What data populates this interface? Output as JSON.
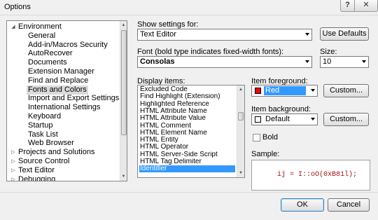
{
  "window": {
    "title": "Options",
    "help_label": "?",
    "close_label": "✕"
  },
  "tree": {
    "items": [
      {
        "label": "Environment",
        "level": 0,
        "expanded": true
      },
      {
        "label": "General",
        "level": 1
      },
      {
        "label": "Add-in/Macros Security",
        "level": 1
      },
      {
        "label": "AutoRecover",
        "level": 1
      },
      {
        "label": "Documents",
        "level": 1
      },
      {
        "label": "Extension Manager",
        "level": 1
      },
      {
        "label": "Find and Replace",
        "level": 1
      },
      {
        "label": "Fonts and Colors",
        "level": 1,
        "selected": true
      },
      {
        "label": "Import and Export Settings",
        "level": 1
      },
      {
        "label": "International Settings",
        "level": 1
      },
      {
        "label": "Keyboard",
        "level": 1
      },
      {
        "label": "Startup",
        "level": 1
      },
      {
        "label": "Task List",
        "level": 1
      },
      {
        "label": "Web Browser",
        "level": 1
      },
      {
        "label": "Projects and Solutions",
        "level": 0,
        "expanded": false
      },
      {
        "label": "Source Control",
        "level": 0,
        "expanded": false
      },
      {
        "label": "Text Editor",
        "level": 0,
        "expanded": false
      },
      {
        "label": "Debugging",
        "level": 0,
        "expanded": false
      }
    ]
  },
  "show_settings": {
    "label": "Show settings for:",
    "value": "Text Editor",
    "use_defaults_label": "Use Defaults"
  },
  "font": {
    "label": "Font (bold type indicates fixed-width fonts):",
    "value": "Consolas",
    "size_label": "Size:",
    "size_value": "10"
  },
  "display_items": {
    "label": "Display items:",
    "items": [
      "Excluded Code",
      "Find Highlight (Extension)",
      "Highlighted Reference",
      "HTML Attribute Name",
      "HTML Attribute Value",
      "HTML Comment",
      "HTML Element Name",
      "HTML Entity",
      "HTML Operator",
      "HTML Server-Side Script",
      "HTML Tag Delimiter",
      "Identifier"
    ],
    "selected_index": 11
  },
  "item_foreground": {
    "label": "Item foreground:",
    "value": "Red",
    "swatch_color": "#ff0000",
    "custom_label": "Custom..."
  },
  "item_background": {
    "label": "Item background:",
    "value": "Default",
    "swatch_color": "#ffffff",
    "custom_label": "Custom..."
  },
  "bold": {
    "label": "Bold",
    "checked": false
  },
  "sample": {
    "label": "Sample:",
    "text": "ij = I::oO(0xB81l);",
    "text_color": "#a31515"
  },
  "footer": {
    "ok_label": "OK",
    "cancel_label": "Cancel"
  },
  "colors": {
    "selection": "#3399ff",
    "tree_selection": "#dadada"
  }
}
